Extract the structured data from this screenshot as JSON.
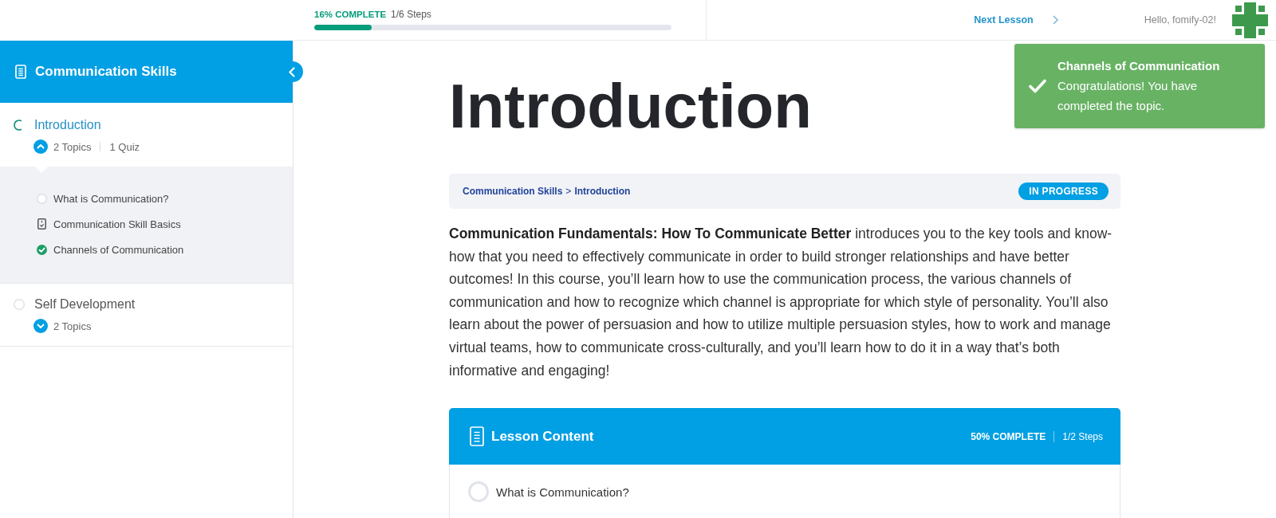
{
  "header": {
    "progress": {
      "percent": "16% COMPLETE",
      "steps": "1/6 Steps",
      "level": 0.16
    },
    "next_lesson": "Next Lesson",
    "greeting": "Hello, fomify-02!"
  },
  "sidebar": {
    "course_title": "Communication Skills",
    "lessons": [
      {
        "title": "Introduction",
        "started": true,
        "selected": true,
        "expanded": true,
        "counts": [
          "2 Topics",
          "1 Quiz"
        ],
        "children": [
          {
            "title": "What is Communication?",
            "kind": "topic",
            "completed": false
          },
          {
            "title": "Communication Skill Basics",
            "kind": "quiz",
            "completed": false
          },
          {
            "title": "Channels of Communication",
            "kind": "topic",
            "completed": true
          }
        ]
      },
      {
        "title": "Self Development",
        "started": false,
        "selected": false,
        "expanded": false,
        "counts": [
          "2 Topics"
        ]
      }
    ]
  },
  "main": {
    "title": "Introduction",
    "breadcrumb": {
      "items": [
        "Communication Skills",
        "Introduction"
      ],
      "separator": ">"
    },
    "status_badge": "IN PROGRESS",
    "description": "**Communication Fundamentals: How To Communicate Better** introduces you to the key tools and know-how that you need to effectively communicate in order to build stronger relationships and have better outcomes! In this course, you’ll learn how to use the communication process, the various channels of communication and how to recognize which channel is appropriate for which style of personality. You’ll also learn about the power of persuasion and how to utilize multiple persuasion styles, how to work and manage virtual teams, how to communicate cross-culturally, and you’ll learn how to do it in a way that’s both informative and engaging!",
    "lesson_content": {
      "title": "Lesson Content",
      "percent": "50% COMPLETE",
      "steps": "1/2 Steps",
      "topics": [
        {
          "title": "What is Communication?",
          "completed": false
        }
      ]
    }
  },
  "toast": {
    "title": "Channels of Communication",
    "message": "Congratulations! You have completed the topic."
  }
}
